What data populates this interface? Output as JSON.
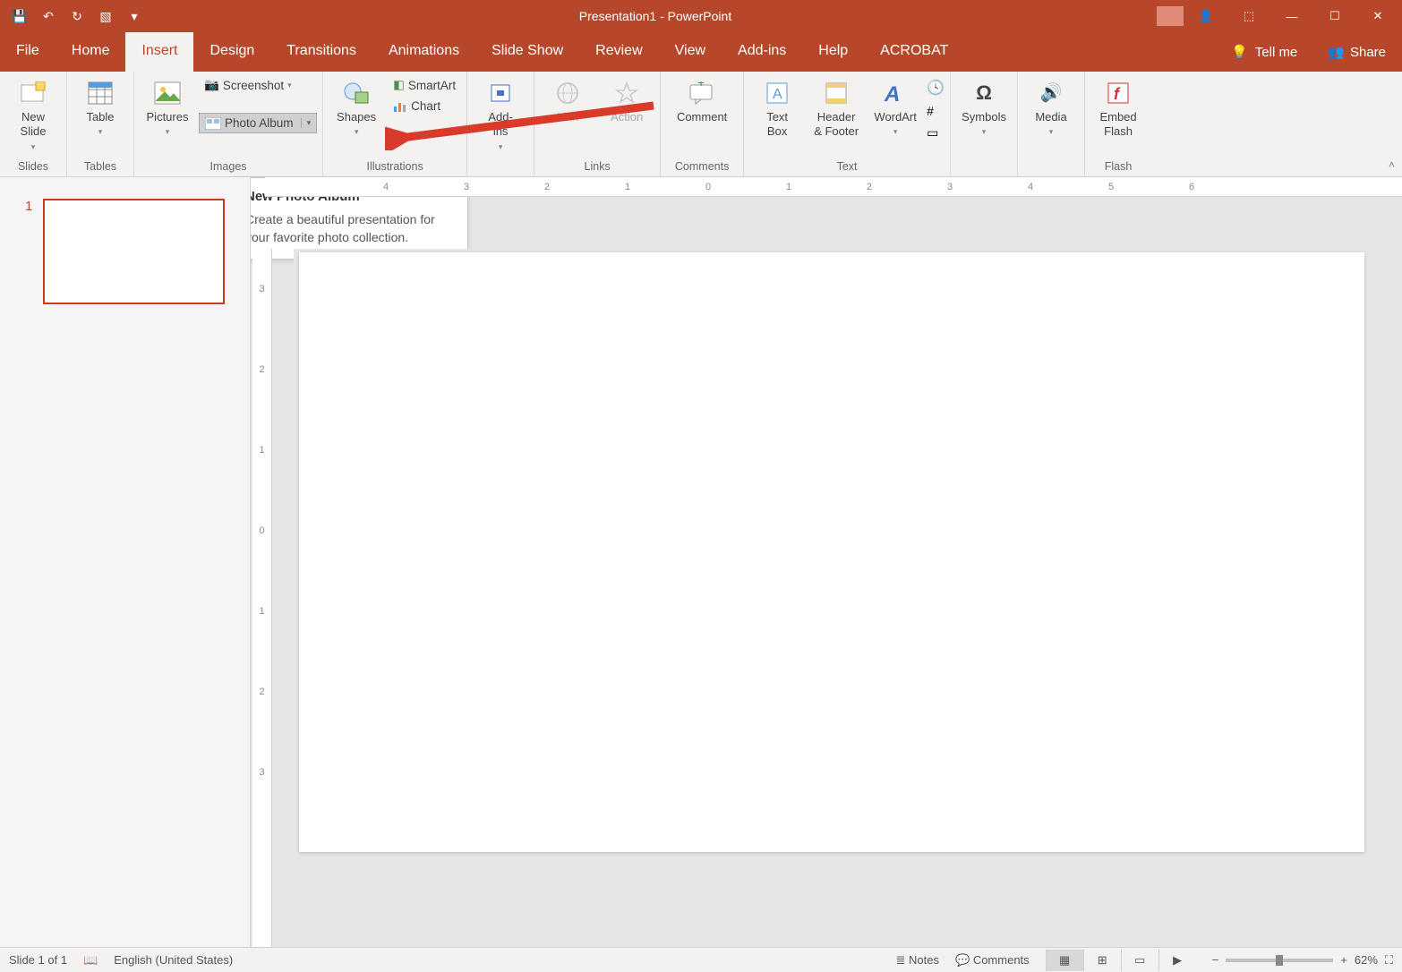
{
  "title": "Presentation1  -  PowerPoint",
  "tabs": [
    "File",
    "Home",
    "Insert",
    "Design",
    "Transitions",
    "Animations",
    "Slide Show",
    "Review",
    "View",
    "Add-ins",
    "Help",
    "ACROBAT"
  ],
  "active_tab_index": 2,
  "tell_me": "Tell me",
  "share": "Share",
  "ribbon": {
    "groups": {
      "slides": {
        "label": "Slides",
        "new_slide": "New\nSlide"
      },
      "tables": {
        "label": "Tables",
        "table": "Table"
      },
      "images": {
        "label": "Images",
        "pictures": "Pictures",
        "screenshot": "Screenshot",
        "photo_album": "Photo Album"
      },
      "illustrations": {
        "label": "Illustrations",
        "shapes": "Shapes",
        "smartart": "SmartArt",
        "chart": "Chart"
      },
      "addins": {
        "label": "",
        "addins": "Add-\nins"
      },
      "links": {
        "label": "Links",
        "link": "Link",
        "action": "Action"
      },
      "comments": {
        "label": "Comments",
        "comment": "Comment"
      },
      "text": {
        "label": "Text",
        "text_box": "Text\nBox",
        "header_footer": "Header\n& Footer",
        "wordart": "WordArt"
      },
      "symbols": {
        "label": "",
        "symbols": "Symbols"
      },
      "media": {
        "label": "",
        "media": "Media"
      },
      "flash": {
        "label": "Flash",
        "embed_flash": "Embed\nFlash"
      }
    }
  },
  "tooltip": {
    "title": "New Photo Album",
    "body": "Create a beautiful presentation for your favorite photo collection."
  },
  "ruler_h": [
    "",
    "4",
    "",
    "3",
    "",
    "2",
    "",
    "1",
    "",
    "0",
    "",
    "1",
    "",
    "2",
    "",
    "3",
    "",
    "4",
    "",
    "5",
    "",
    "6"
  ],
  "ruler_v": [
    "3",
    "2",
    "1",
    "0",
    "1",
    "2",
    "3"
  ],
  "thumbnail": {
    "number": "1"
  },
  "status": {
    "slide": "Slide 1 of 1",
    "language": "English (United States)",
    "notes": "Notes",
    "comments": "Comments",
    "zoom": "62%"
  }
}
